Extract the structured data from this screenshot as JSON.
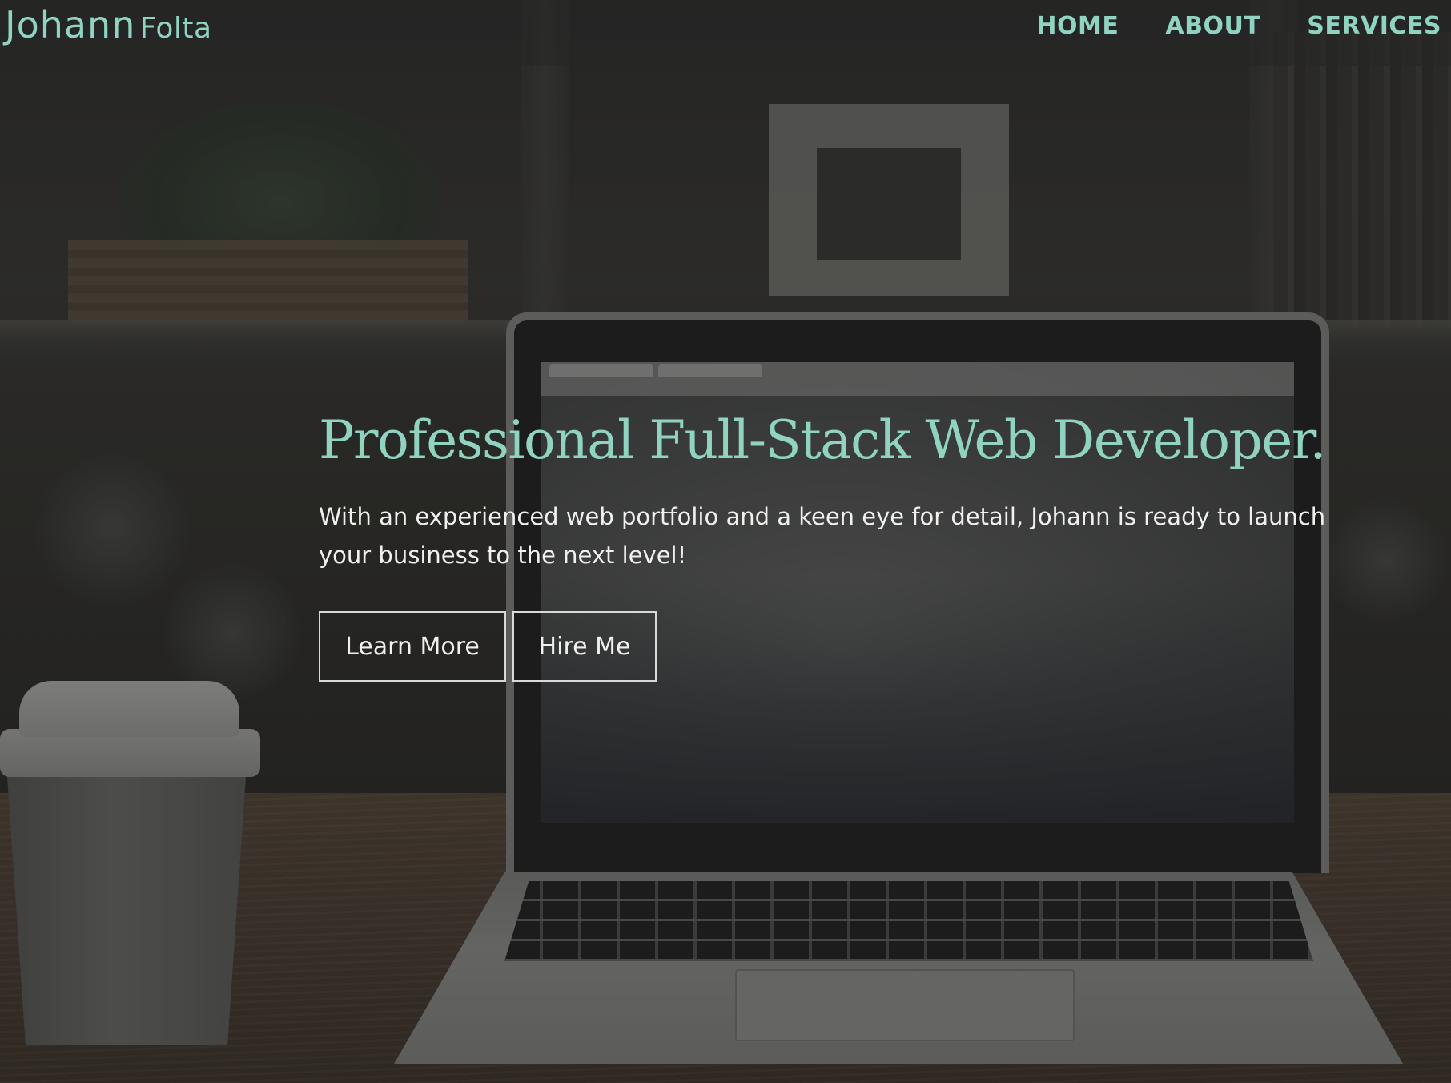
{
  "brand": {
    "first_name": "Johann",
    "last_name": "Folta"
  },
  "nav": {
    "items": [
      {
        "label": "HOME"
      },
      {
        "label": "ABOUT"
      },
      {
        "label": "SERVICES"
      }
    ]
  },
  "hero": {
    "title": "Professional Full-Stack Web Developer.",
    "subtitle": "With an experienced web portfolio and a keen eye for detail, Johann is ready to launch your business to the next level!",
    "buttons": {
      "learn_more": "Learn More",
      "hire_me": "Hire Me"
    }
  },
  "colors": {
    "accent": "#8fd3c0",
    "text_light": "#f0f0ee",
    "navbar_bg": "#262626"
  }
}
